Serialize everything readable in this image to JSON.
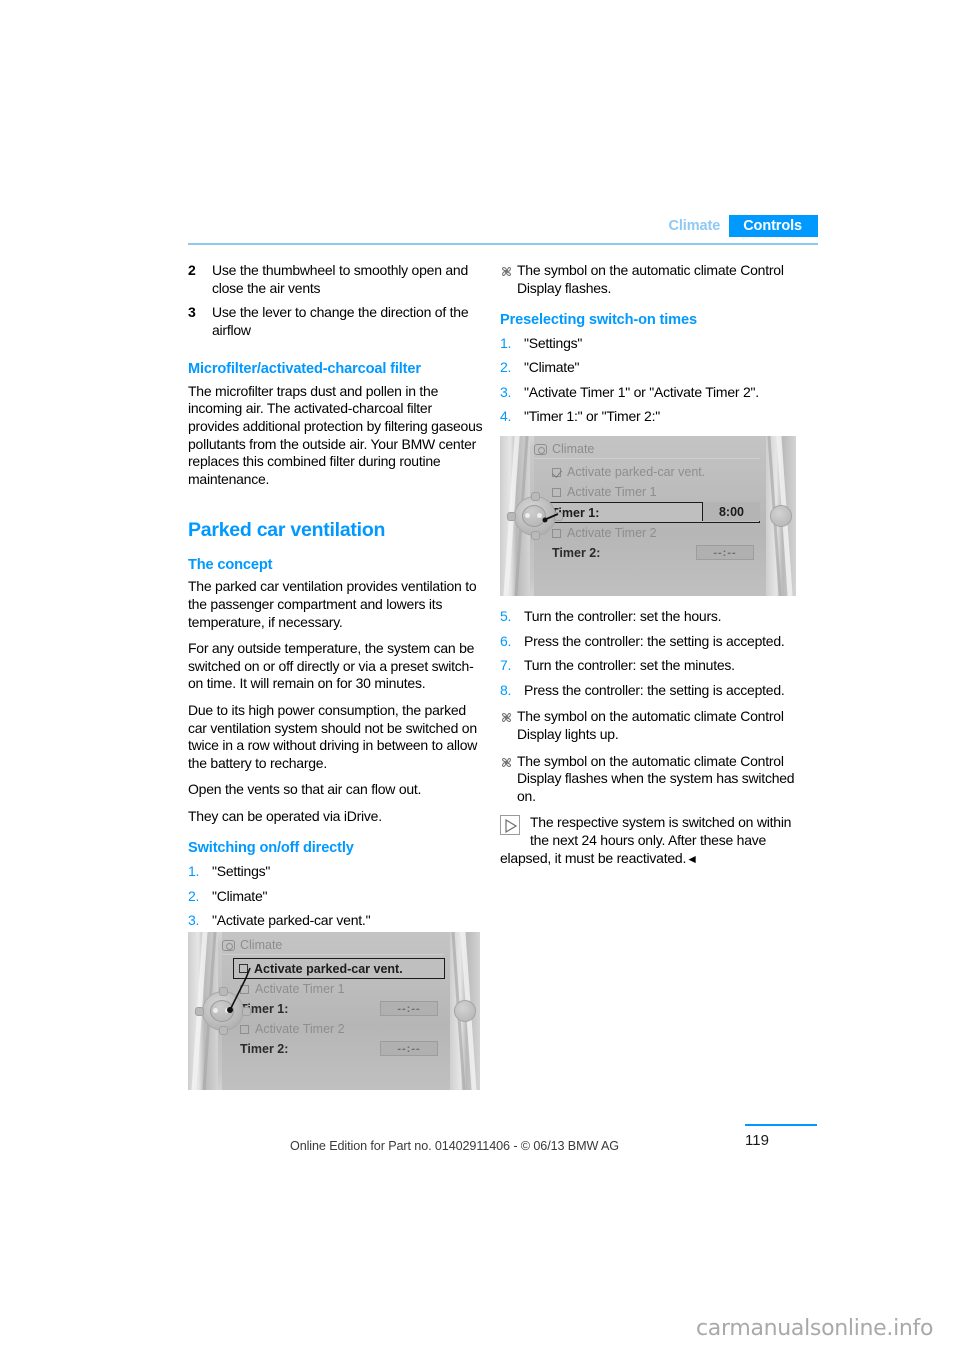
{
  "header": {
    "tab_secondary": "Climate",
    "tab_primary": "Controls",
    "accent_color": "#0099FF",
    "accent_light": "#8ec9f5"
  },
  "left_column": {
    "step2": {
      "num": "2",
      "text": "Use the thumbwheel to smoothly open and close the air vents"
    },
    "step3": {
      "num": "3",
      "text": "Use the lever to change the direction of the airflow"
    },
    "microfilter_heading": "Microfilter/activated-charcoal filter",
    "microfilter_body": "The microfilter traps dust and pollen in the incoming air. The activated-charcoal filter provides additional protection by filtering gaseous pollutants from the outside air. Your BMW center replaces this combined filter during routine maintenance.",
    "parked_title": "Parked car ventilation",
    "concept_heading": "The concept",
    "concept_p1": "The parked car ventilation provides ventilation to the passenger compartment and lowers its temperature, if necessary.",
    "concept_p2": "For any outside temperature, the system can be switched on or off directly or via a preset switch-on time. It will remain on for 30 minutes.",
    "concept_p3": "Due to its high power consumption, the parked car ventilation system should not be switched on twice in a row without driving in between to allow the battery to recharge.",
    "concept_p4": "Open the vents so that air can flow out.",
    "concept_p5": "They can be operated via iDrive.",
    "switching_heading": "Switching on/off directly",
    "switching_steps": [
      {
        "num": "1.",
        "text": "\"Settings\""
      },
      {
        "num": "2.",
        "text": "\"Climate\""
      },
      {
        "num": "3.",
        "text": "\"Activate parked-car vent.\""
      }
    ]
  },
  "right_column": {
    "fan_note_1": "The symbol on the automatic climate Control Display flashes.",
    "preselect_heading": "Preselecting switch-on times",
    "preselect_steps": [
      {
        "num": "1.",
        "text": "\"Settings\""
      },
      {
        "num": "2.",
        "text": "\"Climate\""
      },
      {
        "num": "3.",
        "text": "\"Activate Timer 1\" or \"Activate Timer 2\"."
      },
      {
        "num": "4.",
        "text": "\"Timer 1:\" or \"Timer 2:\""
      }
    ],
    "later_steps": [
      {
        "num": "5.",
        "text": "Turn the controller: set the hours."
      },
      {
        "num": "6.",
        "text": "Press the controller: the setting is accepted."
      },
      {
        "num": "7.",
        "text": "Turn the controller: set the minutes."
      },
      {
        "num": "8.",
        "text": "Press the controller: the setting is accepted."
      }
    ],
    "fan_note_2": "The symbol on the automatic climate Control Display lights up.",
    "fan_note_3": "The symbol on the automatic climate Control Display flashes when the system has switched on.",
    "note_text": "The respective system is switched on within the next 24 hours only. After these have elapsed, it must be reactivated.",
    "note_end_mark": "◄"
  },
  "idrive_left": {
    "window_title": "Climate",
    "rows": [
      {
        "label": "Activate parked-car vent.",
        "checkbox": true,
        "checked": false,
        "selected": true,
        "value": null
      },
      {
        "label": "Activate Timer 1",
        "checkbox": true,
        "checked": false,
        "selected": false,
        "value": null
      },
      {
        "label": "Timer 1:",
        "checkbox": false,
        "checked": false,
        "selected": false,
        "value": "--:--",
        "strong": true
      },
      {
        "label": "Activate Timer 2",
        "checkbox": true,
        "checked": false,
        "selected": false,
        "value": null
      },
      {
        "label": "Timer 2:",
        "checkbox": false,
        "checked": false,
        "selected": false,
        "value": "--:--",
        "strong": true
      }
    ]
  },
  "idrive_right": {
    "window_title": "Climate",
    "rows": [
      {
        "label": "Activate parked-car vent.",
        "checkbox": true,
        "checked": true,
        "selected": false,
        "value": null
      },
      {
        "label": "Activate Timer 1",
        "checkbox": true,
        "checked": false,
        "selected": false,
        "value": null
      },
      {
        "label": "Timer 1:",
        "checkbox": false,
        "checked": false,
        "selected": true,
        "value": "8:00",
        "strong": true
      },
      {
        "label": "Activate Timer 2",
        "checkbox": true,
        "checked": false,
        "selected": false,
        "value": null
      },
      {
        "label": "Timer 2:",
        "checkbox": false,
        "checked": false,
        "selected": false,
        "value": "--:--",
        "strong": true
      }
    ]
  },
  "footer": {
    "edition_line": "Online Edition for Part no. 01402911406 - © 06/13 BMW AG",
    "page_number": "119",
    "watermark": "carmanualsonline.info"
  }
}
